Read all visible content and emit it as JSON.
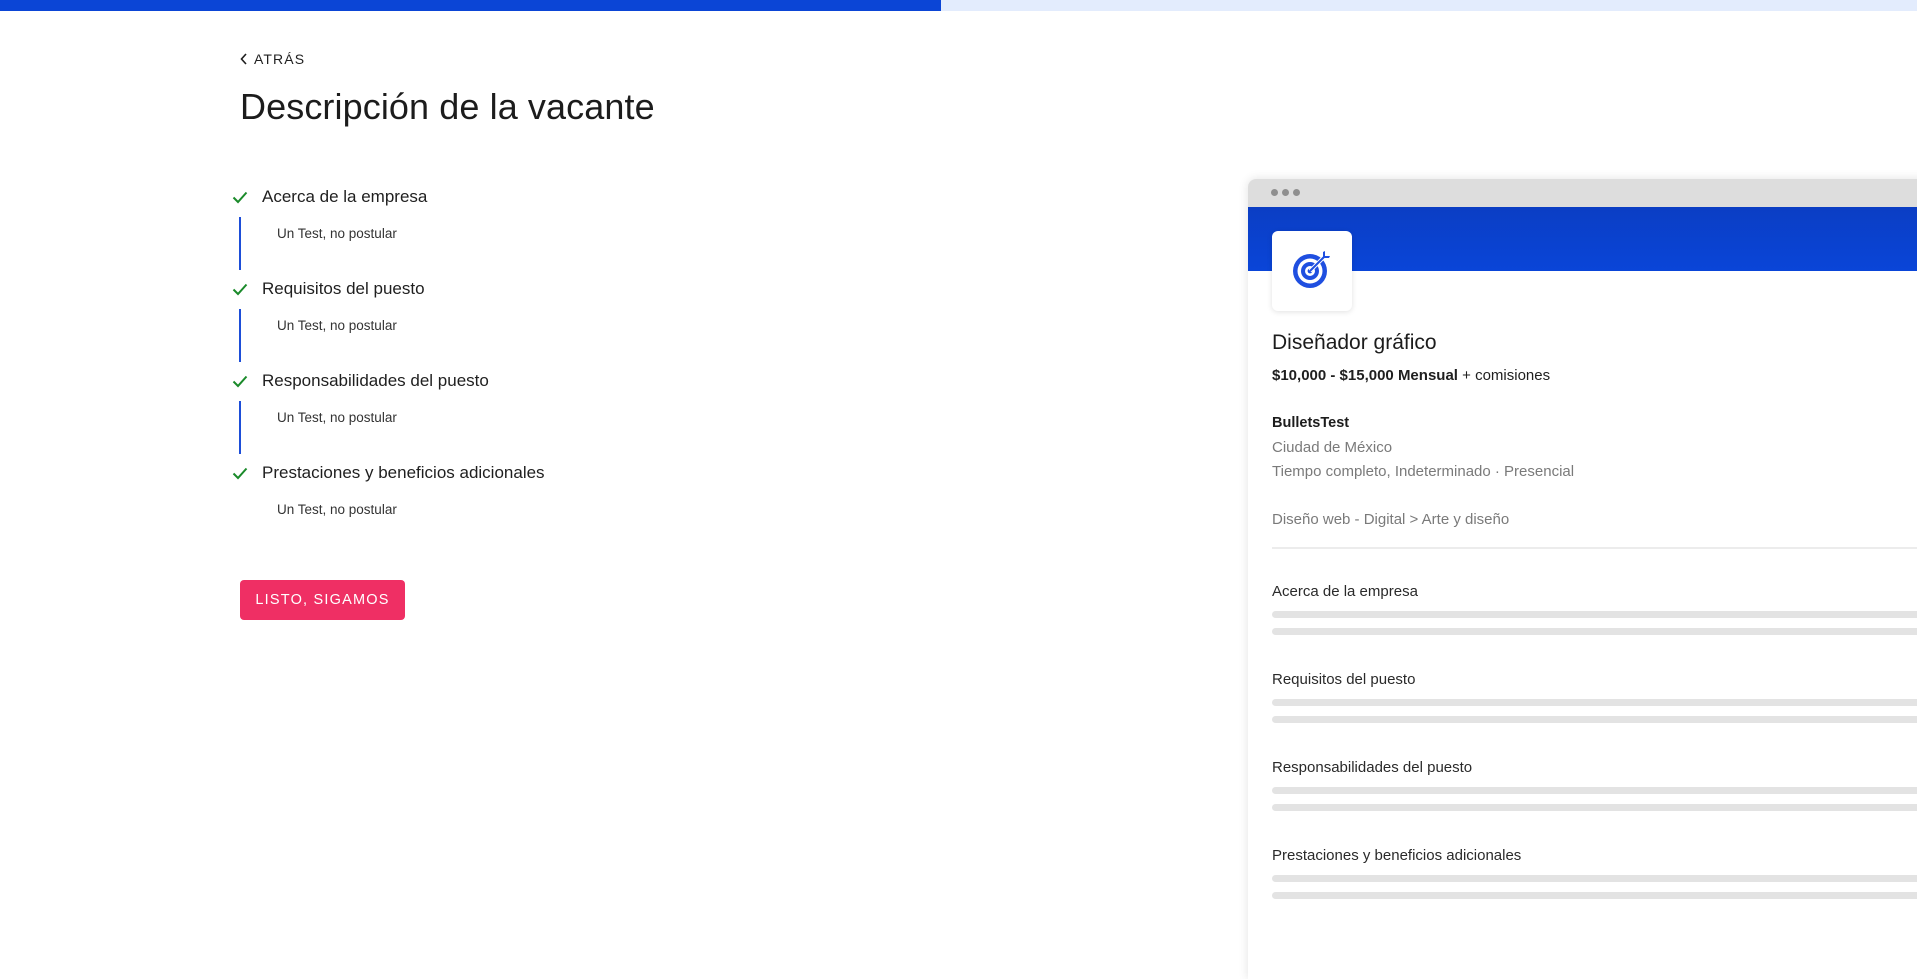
{
  "progress": {
    "percent": 49.1,
    "fill_color": "#0b45d6",
    "track_color": "#e3ecfd"
  },
  "header": {
    "back_label": "ATRÁS",
    "back_icon": "chevron-left-icon",
    "title": "Descripción de la vacante"
  },
  "steps": [
    {
      "title": "Acerca de la empresa",
      "description": "Un Test, no postular",
      "status": "completed",
      "icon": "check-icon"
    },
    {
      "title": "Requisitos del puesto",
      "description": "Un Test, no postular",
      "status": "completed",
      "icon": "check-icon"
    },
    {
      "title": "Responsabilidades del puesto",
      "description": "Un Test, no postular",
      "status": "completed",
      "icon": "check-icon"
    },
    {
      "title": "Prestaciones y beneficios adicionales",
      "description": "Un Test, no postular",
      "status": "completed",
      "icon": "check-icon"
    }
  ],
  "continue_button": {
    "label": "LISTO, SIGAMOS",
    "color": "#ef2f64"
  },
  "preview": {
    "logo_icon": "target-icon",
    "banner_color": "#0a45d8",
    "job_title": "Diseñador gráfico",
    "salary_range": "$10,000 - $15,000 Mensual",
    "salary_extra": "+ comisiones",
    "company": "BulletsTest",
    "location": "Ciudad de México",
    "job_type": "Tiempo completo, Indeterminado · Presencial",
    "category": "Diseño web - Digital > Arte y diseño",
    "sections": [
      "Acerca de la empresa",
      "Requisitos del puesto",
      "Responsabilidades del puesto",
      "Prestaciones y beneficios adicionales"
    ]
  }
}
